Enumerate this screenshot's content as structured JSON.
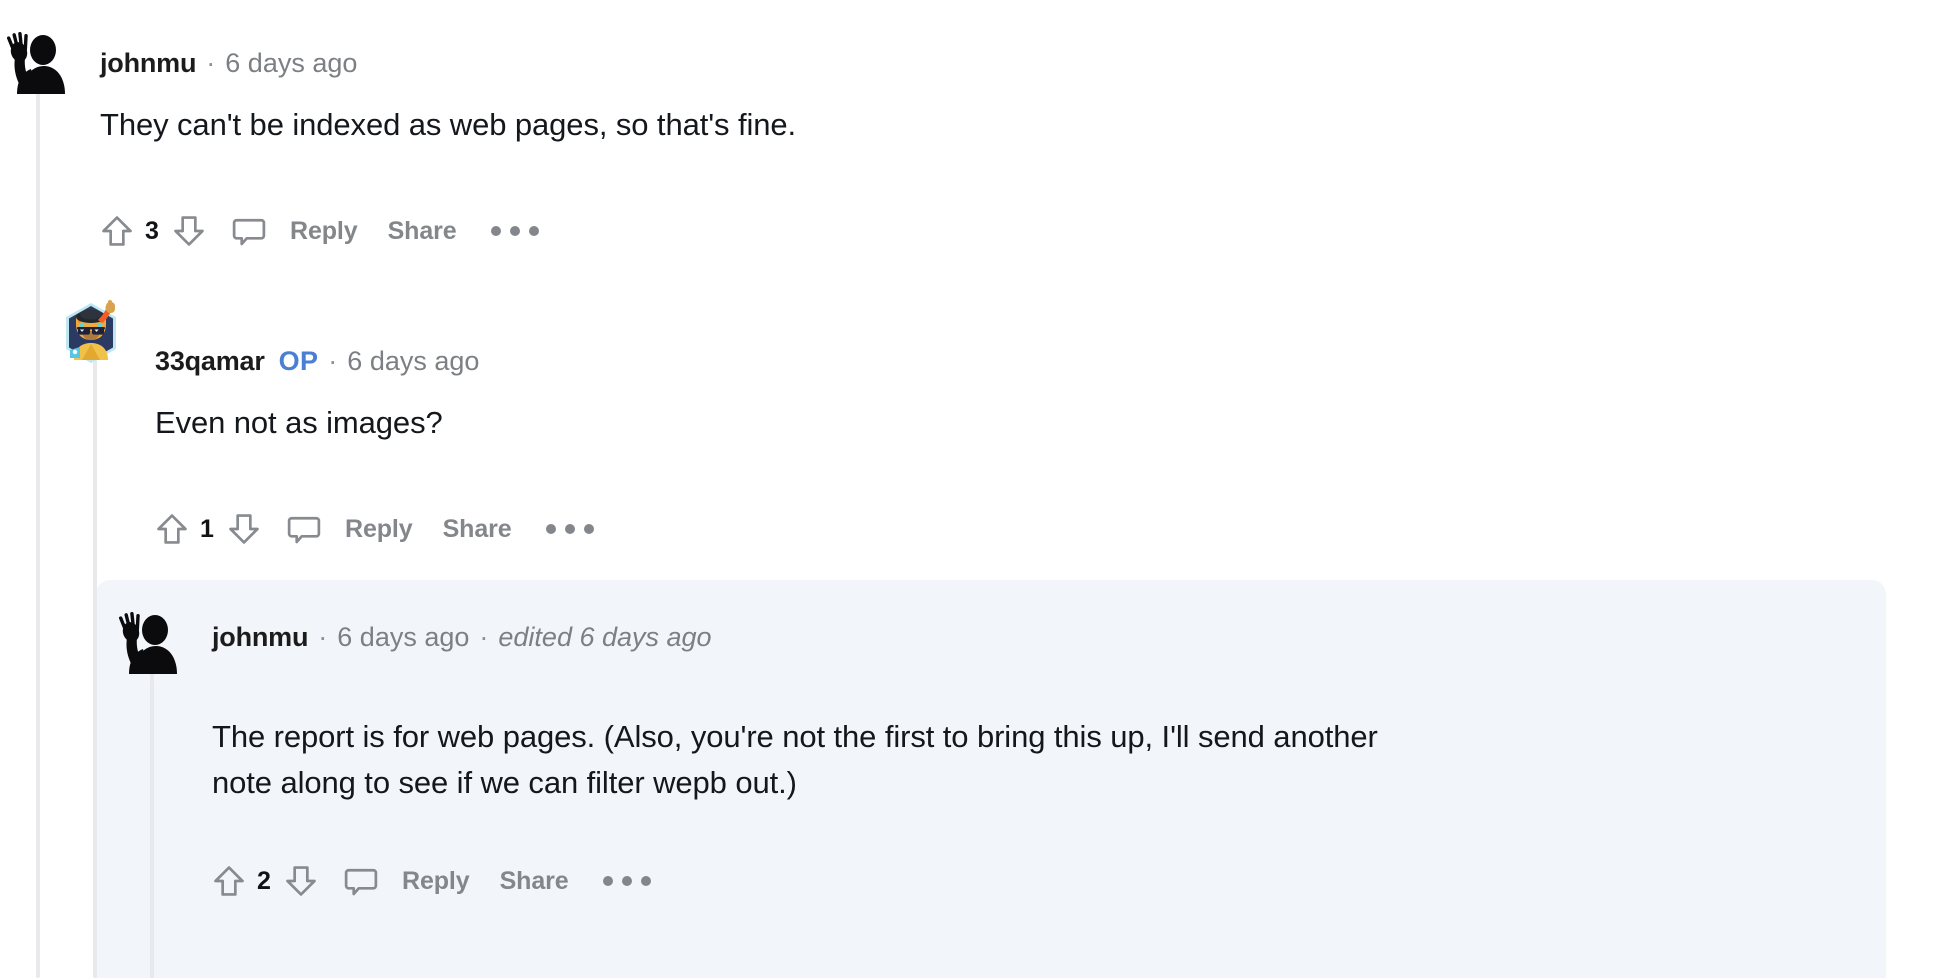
{
  "page": {
    "kind": "reddit-comment-thread",
    "background_color": "#ffffff",
    "highlight_color": "#f2f5fa",
    "threadline_color": "#e7e9ec",
    "op_badge_color": "#4a7fd4",
    "muted_text_color": "#7c7f83",
    "action_text_color": "#83868b"
  },
  "action_labels": {
    "reply": "Reply",
    "share": "Share",
    "upvote_icon": "upvote-arrow-icon",
    "downvote_icon": "downvote-arrow-icon",
    "comment_icon": "comment-bubble-icon",
    "more_icon": "more-options-icon"
  },
  "separator": "·",
  "comments": [
    {
      "id": "c1",
      "author": "johnmu",
      "is_op": false,
      "op_label": "",
      "timestamp": "6 days ago",
      "edited": "",
      "body": "They can't be indexed as web pages, so that's fine.",
      "score": "3",
      "avatar": "waving-person-silhouette-avatar",
      "highlighted": false,
      "depth": 0
    },
    {
      "id": "c2",
      "author": "33qamar",
      "is_op": true,
      "op_label": "OP",
      "timestamp": "6 days ago",
      "edited": "",
      "body": "Even not as images?",
      "score": "1",
      "avatar": "cat-graduate-snoovatar",
      "highlighted": false,
      "depth": 1
    },
    {
      "id": "c3",
      "author": "johnmu",
      "is_op": false,
      "op_label": "",
      "timestamp": "6 days ago",
      "edited": "edited 6 days ago",
      "body_line_1": "The report is for web pages. (Also, you're not the first to bring this up, I'll send another",
      "body_line_2": "note along to see if we can filter wepb out.)",
      "body": "The report is for web pages. (Also, you're not the first to bring this up, I'll send another note along to see if we can filter wepb out.)",
      "score": "2",
      "avatar": "waving-person-silhouette-avatar",
      "highlighted": true,
      "depth": 2
    }
  ]
}
